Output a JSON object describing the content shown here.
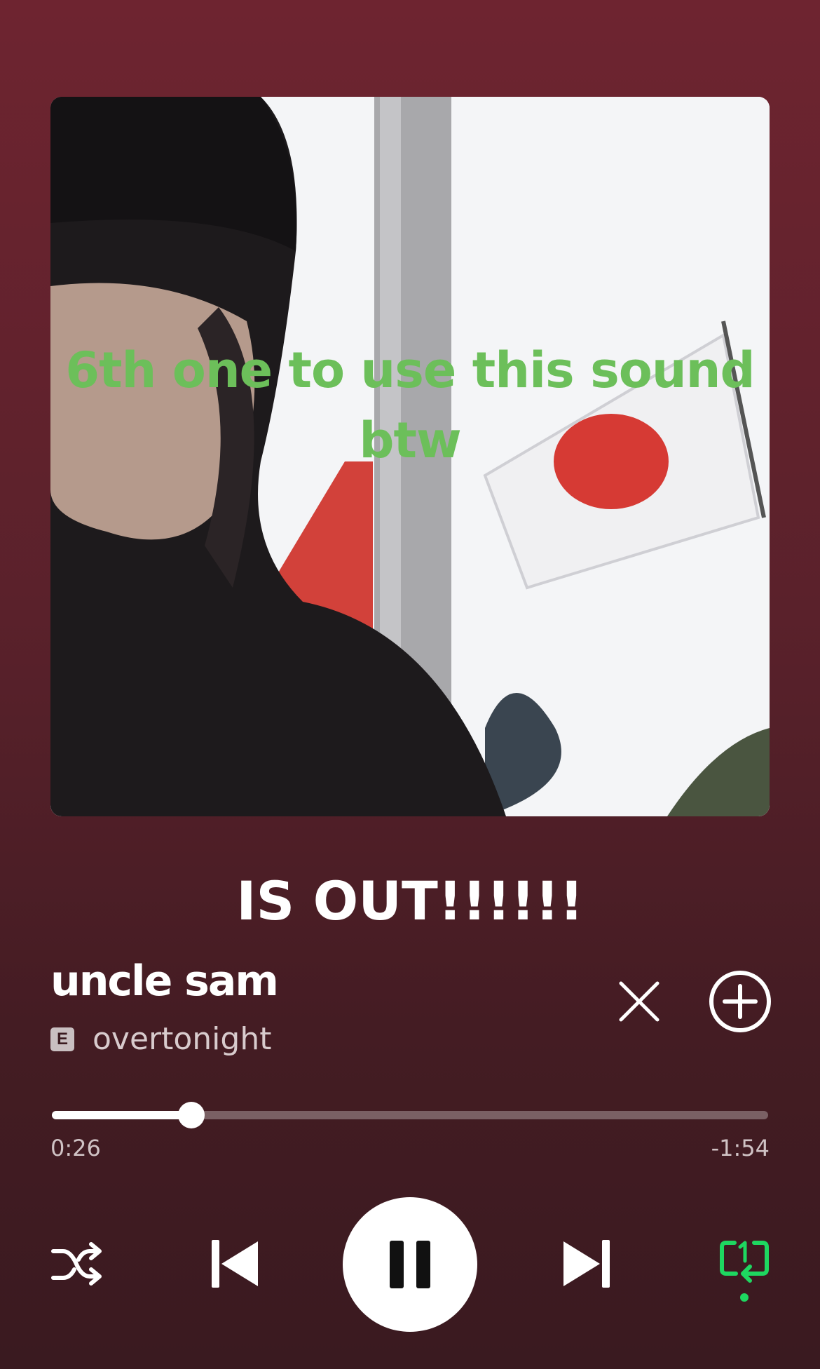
{
  "album_art": {
    "overlay_text_line1": "6th one to use this sound",
    "overlay_text_line2": "btw",
    "overlay_text_color": "#6cbf5a"
  },
  "caption": "IS OUT!!!!!!",
  "track": {
    "title": "uncle sam",
    "explicit_badge": "E",
    "artist": "overtonight"
  },
  "actions": {
    "dismiss_icon": "close-icon",
    "add_icon": "add-circle-icon"
  },
  "playback": {
    "elapsed": "0:26",
    "remaining": "-1:54",
    "progress": 0.195,
    "state": "playing",
    "repeat_mode": "repeat-one",
    "accent_color": "#1ed760"
  },
  "controls": {
    "shuffle_icon": "shuffle-icon",
    "previous_icon": "skip-previous-icon",
    "pause_icon": "pause-icon",
    "next_icon": "skip-next-icon",
    "repeat_icon": "repeat-one-icon"
  }
}
